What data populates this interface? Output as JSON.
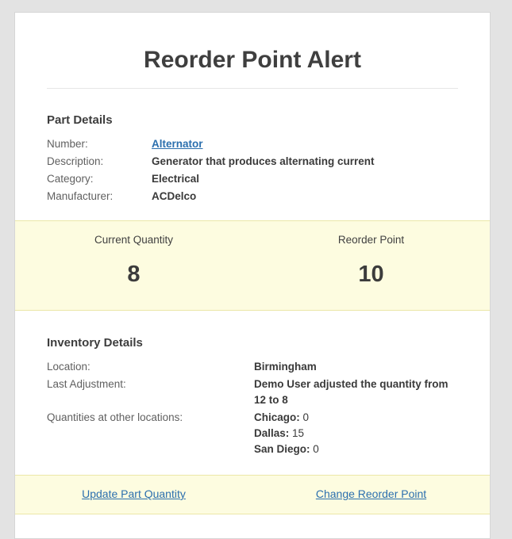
{
  "title": "Reorder Point Alert",
  "part_details": {
    "heading": "Part Details",
    "rows": [
      {
        "label": "Number:",
        "value": "Alternator"
      },
      {
        "label": "Description:",
        "value": "Generator that produces alternating current"
      },
      {
        "label": "Category:",
        "value": "Electrical"
      },
      {
        "label": "Manufacturer:",
        "value": "ACDelco"
      }
    ]
  },
  "quantities": {
    "current_label": "Current Quantity",
    "current_value": "8",
    "reorder_label": "Reorder Point",
    "reorder_value": "10"
  },
  "inventory_details": {
    "heading": "Inventory Details",
    "location_label": "Location:",
    "location_value": "Birmingham",
    "adjustment_label": "Last Adjustment:",
    "adjustment_value": "Demo User adjusted the quantity from 12 to 8",
    "other_label": "Quantities at other locations:",
    "other_locations": [
      {
        "name": "Chicago:",
        "qty": "0"
      },
      {
        "name": "Dallas:",
        "qty": "15"
      },
      {
        "name": "San Diego:",
        "qty": "0"
      }
    ]
  },
  "actions": {
    "update_label": "Update Part Quantity",
    "change_label": "Change Reorder Point"
  },
  "colors": {
    "link": "#2b6fae",
    "highlight_band": "#fdfce0",
    "band_border": "#ebe7a8"
  }
}
